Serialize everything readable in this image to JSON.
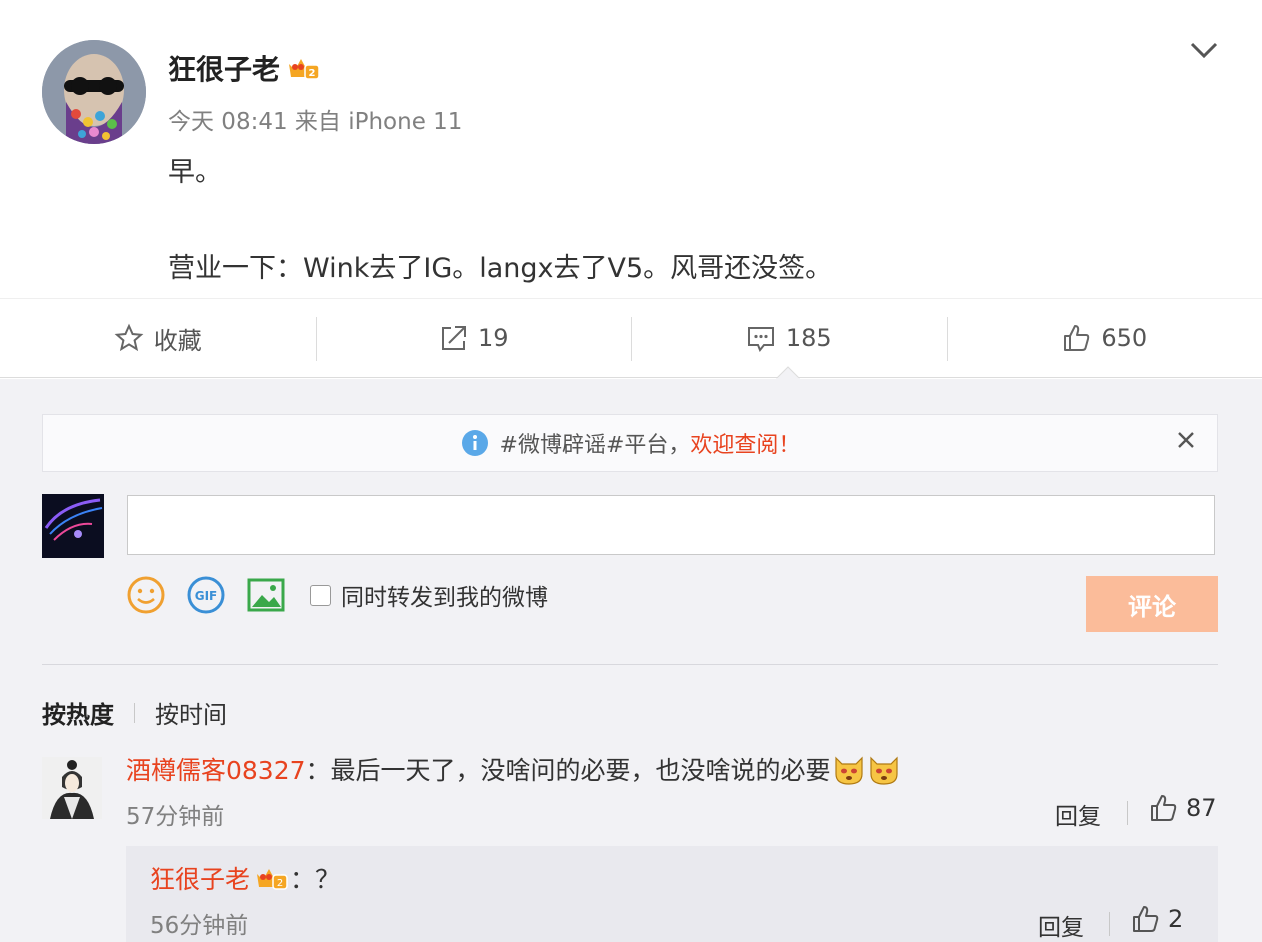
{
  "post": {
    "author": "狂很子老",
    "meta": "今天 08:41 来自 iPhone 11",
    "line1": "早。",
    "line2": "营业一下：Wink去了IG。langx去了V5。风哥还没签。"
  },
  "actions": {
    "favorite_label": "收藏",
    "repost_count": "19",
    "comment_count": "185",
    "like_count": "650"
  },
  "notice": {
    "text": "#微博辟谣#平台，",
    "highlight": "欢迎查阅！"
  },
  "composer": {
    "input_value": "",
    "repost_label": "同时转发到我的微博",
    "submit_label": "评论"
  },
  "sort": {
    "hot": "按热度",
    "time": "按时间"
  },
  "comment": {
    "user": "酒樽儒客08327",
    "text": "：最后一天了，没啥问的必要，也没啥说的必要",
    "time": "57分钟前",
    "reply_label": "回复",
    "likes": "87"
  },
  "reply": {
    "user": "狂很子老",
    "text": "：？",
    "time": "56分钟前",
    "reply_label": "回复",
    "likes": "2"
  },
  "colors": {
    "accent": "#e8431f",
    "submit_disabled": "#fbbc9a",
    "comment_bg": "#f2f2f5"
  },
  "icons": [
    "chevron-down-icon",
    "star-icon",
    "share-icon",
    "comment-icon",
    "thumbs-up-icon",
    "info-icon",
    "close-icon",
    "emoji-icon",
    "gif-icon",
    "image-icon",
    "vip-crown-icon"
  ]
}
